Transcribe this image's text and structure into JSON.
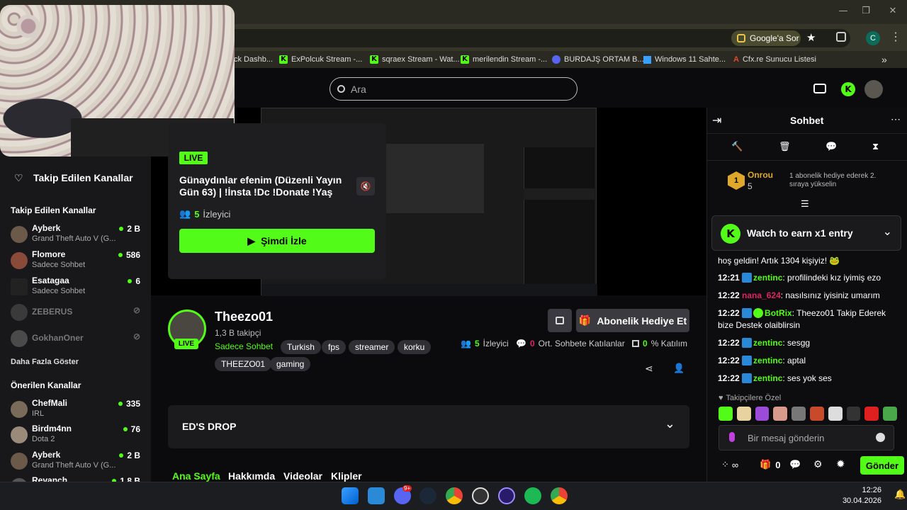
{
  "browser": {
    "window_controls": [
      "—",
      "❐",
      "✕"
    ],
    "google_ask": "Google'a Sor",
    "profile_letter": "C",
    "bookmarks": [
      {
        "label": "ck Dashb...",
        "icon": "dashboard-icon"
      },
      {
        "label": "ExPolcuk Stream -...",
        "icon": "kick-icon"
      },
      {
        "label": "sqraex Stream - Wat...",
        "icon": "kick-icon"
      },
      {
        "label": "merilendin Stream -...",
        "icon": "kick-icon"
      },
      {
        "label": "BURDAJŞ ORTAM B...",
        "icon": "discord-icon"
      },
      {
        "label": "Windows 11 Sahte...",
        "icon": "windows-icon"
      },
      {
        "label": "Cfx.re Sunucu Listesi",
        "icon": "cfx-icon"
      }
    ],
    "bookmarks_more": "»"
  },
  "kick_header": {
    "search_placeholder": "Ara"
  },
  "sidebar": {
    "followed_heading": "Takip Edilen Kanallar",
    "followed_section_title": "Takip Edilen Kanallar",
    "followed": [
      {
        "name": "Ayberk",
        "sub": "Grand Theft Auto V (G...",
        "viewers": "2 B",
        "live": true
      },
      {
        "name": "Flomore",
        "sub": "Sadece Sohbet",
        "viewers": "586",
        "live": true
      },
      {
        "name": "Esatagaa",
        "sub": "Sadece Sohbet",
        "viewers": "6",
        "live": true
      },
      {
        "name": "ZEBERUS",
        "sub": "",
        "viewers": "",
        "live": false
      },
      {
        "name": "GokhanOner",
        "sub": "",
        "viewers": "",
        "live": false
      }
    ],
    "show_more": "Daha Fazla Göster",
    "recommended_title": "Önerilen Kanallar",
    "recommended": [
      {
        "name": "ChefMali",
        "sub": "IRL",
        "viewers": "335"
      },
      {
        "name": "Birdm4nn",
        "sub": "Dota 2",
        "viewers": "76"
      },
      {
        "name": "Ayberk",
        "sub": "Grand Theft Auto V (G...",
        "viewers": "2 B"
      },
      {
        "name": "Revanch",
        "sub": "",
        "viewers": "1,8 B"
      }
    ]
  },
  "popup": {
    "live": "LIVE",
    "title": "Günaydınlar efenim (Düzenli Yayın Gün 63) | !İnsta !Dc !Donate !Yaş",
    "viewers_count": "5",
    "viewers_label": "İzleyici",
    "watch_now": "Şimdi İzle"
  },
  "channel": {
    "name": "Theezo01",
    "followers": "1,3 B takipçi",
    "category": "Sadece Sohbet",
    "live": "LIVE",
    "tags": [
      "Turkish",
      "fps",
      "streamer",
      "korku",
      "THEEZO01",
      "gaming"
    ],
    "viewers_count": "5",
    "viewers_label": "İzleyici",
    "chat_participants_count": "0",
    "chat_participants_label": "Ort. Sohbete Katılanlar",
    "participation_count": "0",
    "participation_label": "% Katılım",
    "sub_gift": "Abonelik Hediye Et",
    "drop_title": "ED'S DROP",
    "tabs": [
      "Ana Sayfa",
      "Hakkımda",
      "Videolar",
      "Klipler"
    ]
  },
  "chat": {
    "title": "Sohbet",
    "top_gifter": {
      "name": "Onrou",
      "count": "5",
      "rank": "1"
    },
    "next_rank_text": "1 abonelik hediye ederek 2. sıraya yükselin",
    "watch_earn": "Watch to earn x1 entry",
    "messages": [
      {
        "time": "",
        "user": "",
        "text": "hoş geldin! Artık 1304 kişiyiz! 🐸",
        "color": "#ffffff"
      },
      {
        "time": "12:21",
        "user": "zentinc",
        "text": ": profilindeki kız iyimiş ezo",
        "color": "#53fc18"
      },
      {
        "time": "12:22",
        "user": "nana_624",
        "text": ": nasılsınız iyisiniz umarım",
        "color": "#e0245e"
      },
      {
        "time": "12:22",
        "user": "BotRix",
        "text": ": Theezo01 Takip Ederek bize Destek olaiblirsin",
        "color": "#53fc18"
      },
      {
        "time": "12:22",
        "user": "zentinc",
        "text": ": sesgg",
        "color": "#53fc18"
      },
      {
        "time": "12:22",
        "user": "zentinc",
        "text": ": aptal",
        "color": "#53fc18"
      },
      {
        "time": "12:22",
        "user": "zentinc",
        "text": ": ses yok ses",
        "color": "#53fc18"
      }
    ],
    "followers_only": "Takipçilere Özel",
    "input_placeholder": "Bir mesaj gönderin",
    "points": "∞",
    "gift_count": "0",
    "send": "Gönder"
  },
  "taskbar": {
    "time": "12:26",
    "date": "30.04.2026",
    "discord_badge": "9+"
  },
  "colors": {
    "accent": "#53fc18",
    "bg": "#0b0b0d",
    "panel": "#18181b"
  }
}
